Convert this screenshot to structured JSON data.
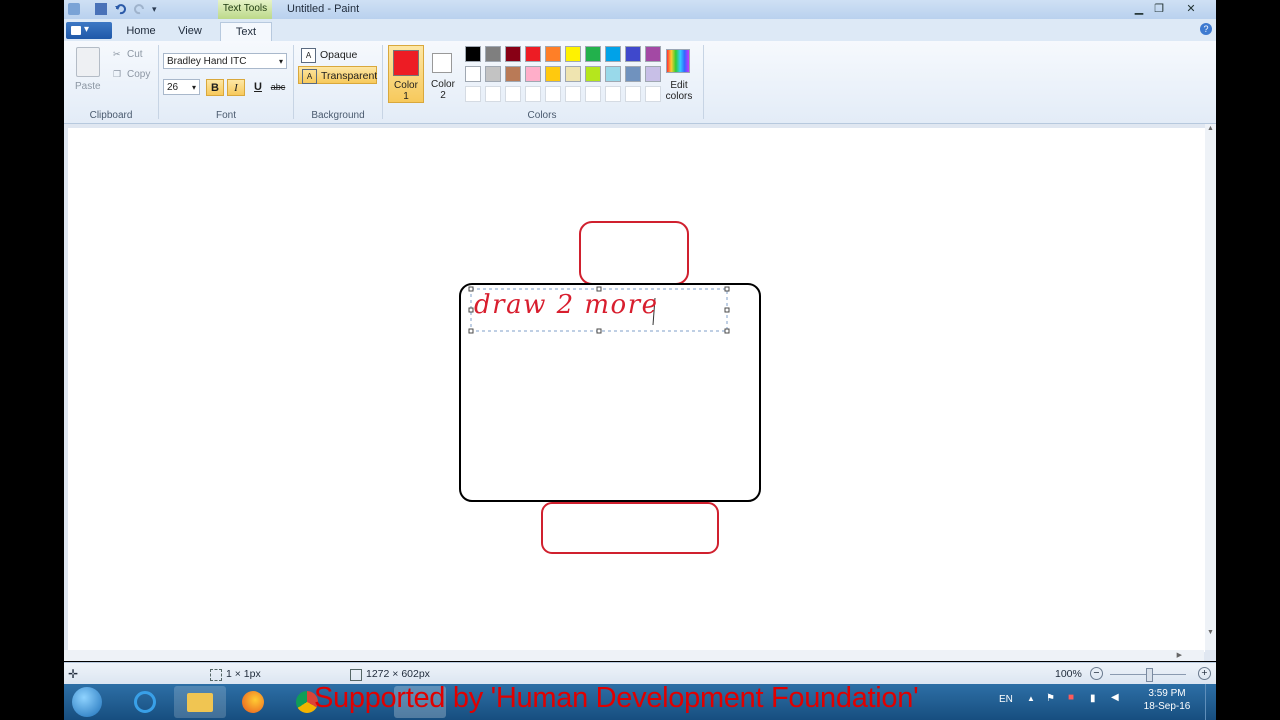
{
  "titlebar": {
    "title": "Untitled - Paint",
    "context_tab": "Text Tools"
  },
  "tabs": [
    {
      "label": "Home"
    },
    {
      "label": "View"
    },
    {
      "label": "Text"
    }
  ],
  "ribbon": {
    "clipboard": {
      "paste": "Paste",
      "cut": "Cut",
      "copy": "Copy",
      "group": "Clipboard"
    },
    "font": {
      "family": "Bradley Hand ITC",
      "size": "26",
      "bold": "B",
      "italic": "I",
      "underline": "U",
      "strike": "abc",
      "group": "Font"
    },
    "background": {
      "opaque": "Opaque",
      "transparent": "Transparent",
      "group": "Background"
    },
    "colors": {
      "color1_label": "Color 1",
      "color1_line1": "Color",
      "color1_line2": "1",
      "color2_line1": "Color",
      "color2_line2": "2",
      "edit_line1": "Edit",
      "edit_line2": "colors",
      "group": "Colors",
      "color1": "#ed1c24",
      "color2": "#ffffff",
      "palette_row1": [
        "#000000",
        "#7f7f7f",
        "#880015",
        "#ed1c24",
        "#ff7f27",
        "#fff200",
        "#22b14c",
        "#00a2e8",
        "#3f48cc",
        "#a349a4"
      ],
      "palette_row2": [
        "#ffffff",
        "#c3c3c3",
        "#b97a57",
        "#ffaec9",
        "#ffc90e",
        "#efe4b0",
        "#b5e61d",
        "#99d9ea",
        "#7092be",
        "#c8bfe7"
      ]
    }
  },
  "canvas": {
    "text": "draw 2 more",
    "text_color": "#d81e2e",
    "outline_color": "#d0202e"
  },
  "status": {
    "selection": "1 × 1px",
    "size": "1272 × 602px",
    "zoom": "100%"
  },
  "taskbar": {
    "banner": "Supported by 'Human Development Foundation'",
    "lang": "EN",
    "time": "3:59 PM",
    "date": "18-Sep-16"
  }
}
